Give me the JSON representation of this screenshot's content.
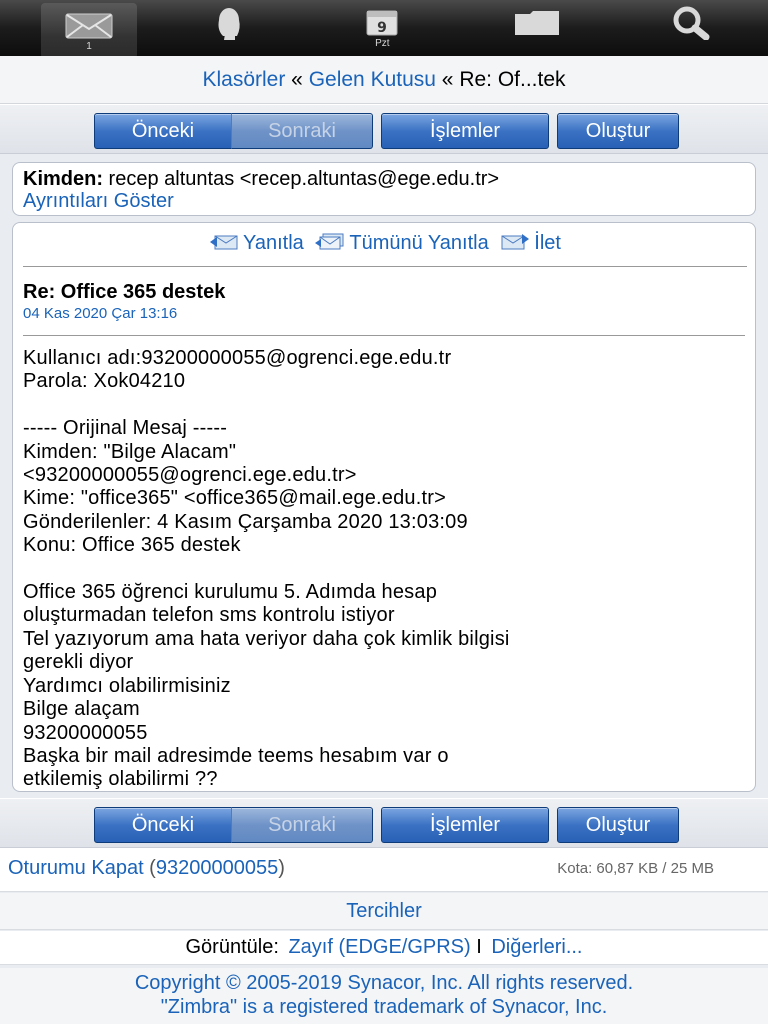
{
  "tabbar": {
    "tabs": [
      {
        "icon": "mail-icon",
        "label": "1"
      },
      {
        "icon": "contacts-icon",
        "label": ""
      },
      {
        "icon": "calendar-icon",
        "label": "Pzt",
        "day": "9"
      },
      {
        "icon": "folder-icon",
        "label": ""
      },
      {
        "icon": "search-icon",
        "label": ""
      }
    ]
  },
  "breadcrumb": {
    "folders": "Klasörler",
    "sep1": " « ",
    "inbox": "Gelen Kutusu",
    "sep2": " « ",
    "current": "Re: Of...tek"
  },
  "toolbar": {
    "prev": "Önceki",
    "next": "Sonraki",
    "actions": "İşlemler",
    "compose": "Oluştur"
  },
  "sender": {
    "label": "Kimden:",
    "value": " recep altuntas <recep.altuntas@ege.edu.tr>",
    "details_link": "Ayrıntıları Göster"
  },
  "message": {
    "reply": "Yanıtla",
    "reply_all": "Tümünü Yanıtla",
    "forward": "İlet",
    "subject": "Re: Office 365 destek",
    "date": "04 Kas 2020 Çar 13:16",
    "body_lines": [
      "Kullanıcı adı:93200000055@ogrenci.ege.edu.tr",
      "Parola: Xok04210",
      "",
      "----- Orijinal Mesaj -----",
      "Kimden: \"Bilge Alacam\"",
      "<93200000055@ogrenci.ege.edu.tr>",
      "Kime: \"office365\" <office365@mail.ege.edu.tr>",
      "Gönderilenler: 4 Kasım Çarşamba 2020 13:03:09",
      "Konu: Office 365 destek",
      "",
      "Office 365 öğrenci kurulumu 5. Adımda hesap",
      "oluşturmadan telefon sms kontrolu istiyor",
      "Tel yazıyorum ama hata veriyor daha çok kimlik bilgisi",
      "gerekli diyor",
      "Yardımcı olabilirmisiniz",
      "Bilge alaçam",
      "93200000055",
      "Başka bir mail adresimde teems hesabım var o",
      "etkilemiş olabilirmi ??"
    ]
  },
  "footer": {
    "logout": "Oturumu Kapat",
    "paren_open": " (",
    "account": "93200000055",
    "paren_close": ")",
    "quota": "Kota: 60,87 KB / 25 MB",
    "prefs": "Tercihler",
    "view_label": "Görüntüle:",
    "view_current": "Zayıf (EDGE/GPRS)",
    "view_sep": " I ",
    "view_others": "Diğerleri...",
    "copyright_1": "Copyright © 2005-2019 Synacor, Inc. All rights reserved.",
    "copyright_2": "\"Zimbra\" is a registered trademark of Synacor, Inc."
  },
  "colors": {
    "link": "#1a63b8",
    "button": "#3b72c3"
  }
}
